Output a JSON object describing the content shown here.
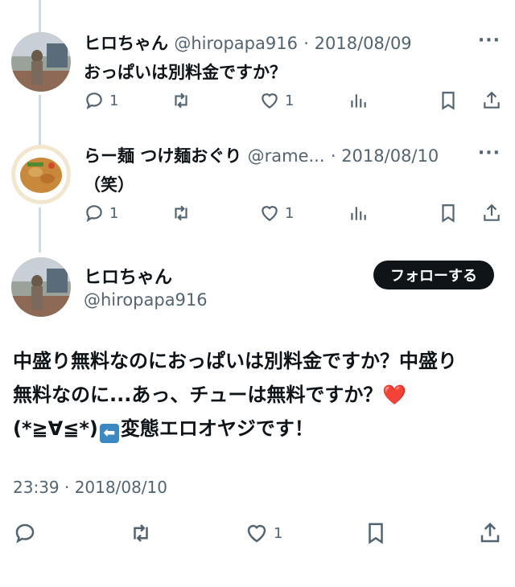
{
  "tweets": [
    {
      "name": "ヒロちゃん",
      "handle": "@hiropapa916",
      "date": "· 2018/08/09",
      "text": "おっぱいは別料金ですか？",
      "reply_count": "1",
      "like_count": "1",
      "more": "···"
    },
    {
      "name": "らー麺 つけ麺おぐり",
      "handle": "@rame...",
      "date": "· 2018/08/10",
      "text": "（笑）",
      "reply_count": "1",
      "like_count": "1",
      "more": "···"
    }
  ],
  "main": {
    "name": "ヒロちゃん",
    "handle": "@hiropapa916",
    "follow_label": "フォローする",
    "line1": "中盛り無料なのにおっぱいは別料金ですか？中盛り",
    "line2a": "無料なのに...あっ、チューは無料ですか？",
    "heart": "❤️",
    "line3a": "(*≧∀≦*)",
    "back_arrow": "⬅",
    "line3b": "変態エロオヤジです！",
    "timestamp": "23:39 · 2018/08/10",
    "like_count": "1"
  },
  "colors": {
    "accent_text": "#0f1419",
    "secondary_text": "#536471",
    "thread_line": "#cfd9de",
    "button_bg": "#0f1419"
  },
  "icons": [
    "reply-icon",
    "retweet-icon",
    "like-icon",
    "views-icon",
    "bookmark-icon",
    "share-icon"
  ]
}
